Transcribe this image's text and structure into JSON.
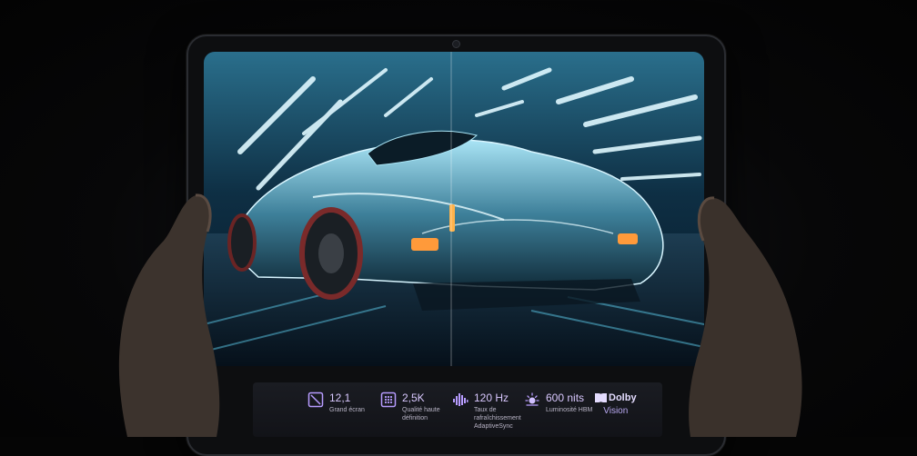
{
  "specs": [
    {
      "icon": "screen-size-icon",
      "value": "12,1",
      "label": "Grand écran"
    },
    {
      "icon": "resolution-grid-icon",
      "value": "2,5K",
      "label": "Qualité haute définition"
    },
    {
      "icon": "refresh-wave-icon",
      "value": "120 Hz",
      "label": "Taux de rafraîchissement AdaptiveSync"
    },
    {
      "icon": "brightness-sun-icon",
      "value": "600 nits",
      "label": "Luminosité HBM"
    },
    {
      "icon": "dolby-icon",
      "value": "Dolby",
      "label": "Vision"
    }
  ],
  "colors": {
    "accent": "#b79cff",
    "value_text": "#d9c8ff",
    "screen_glow": "#7fe6ff"
  }
}
